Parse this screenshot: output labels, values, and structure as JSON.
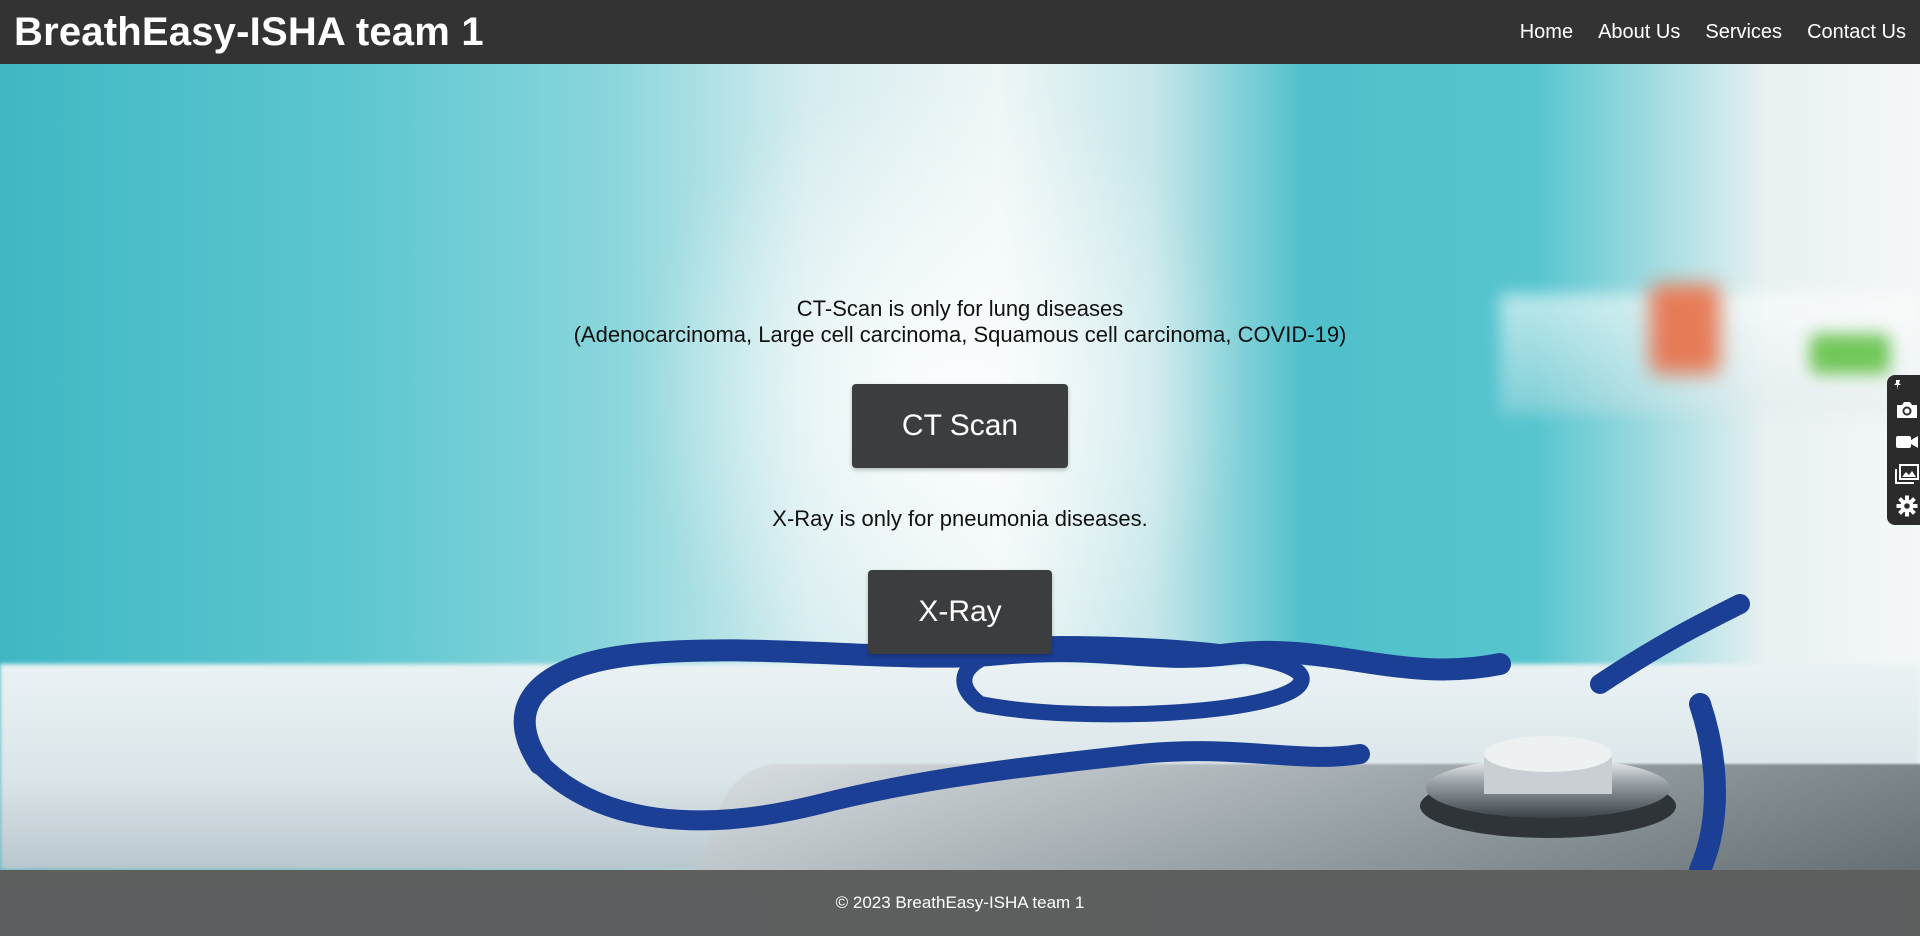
{
  "header": {
    "site_title": "BreathEasy-ISHA team 1",
    "nav": [
      {
        "label": "Home"
      },
      {
        "label": "About Us"
      },
      {
        "label": "Services"
      },
      {
        "label": "Contact Us"
      }
    ]
  },
  "main": {
    "ct_info_line1": "CT-Scan is only for lung diseases",
    "ct_info_line2": "(Adenocarcinoma, Large cell carcinoma, Squamous cell carcinoma, COVID-19)",
    "ct_button_label": "CT Scan",
    "xray_info": "X-Ray is only for pneumonia diseases.",
    "xray_button_label": "X-Ray"
  },
  "footer": {
    "copyright": "© 2023 BreathEasy-ISHA team 1"
  },
  "side_toolbar": {
    "icons": [
      "pin-icon",
      "camera-icon",
      "video-camera-icon",
      "gallery-icon",
      "gear-icon"
    ]
  },
  "colors": {
    "header_bg": "#333333",
    "button_bg": "#3c3d3f",
    "footer_bg": "#4b4b4b",
    "hero_teal": "#3fb8c4",
    "stethoscope_blue": "#1c3f96"
  }
}
